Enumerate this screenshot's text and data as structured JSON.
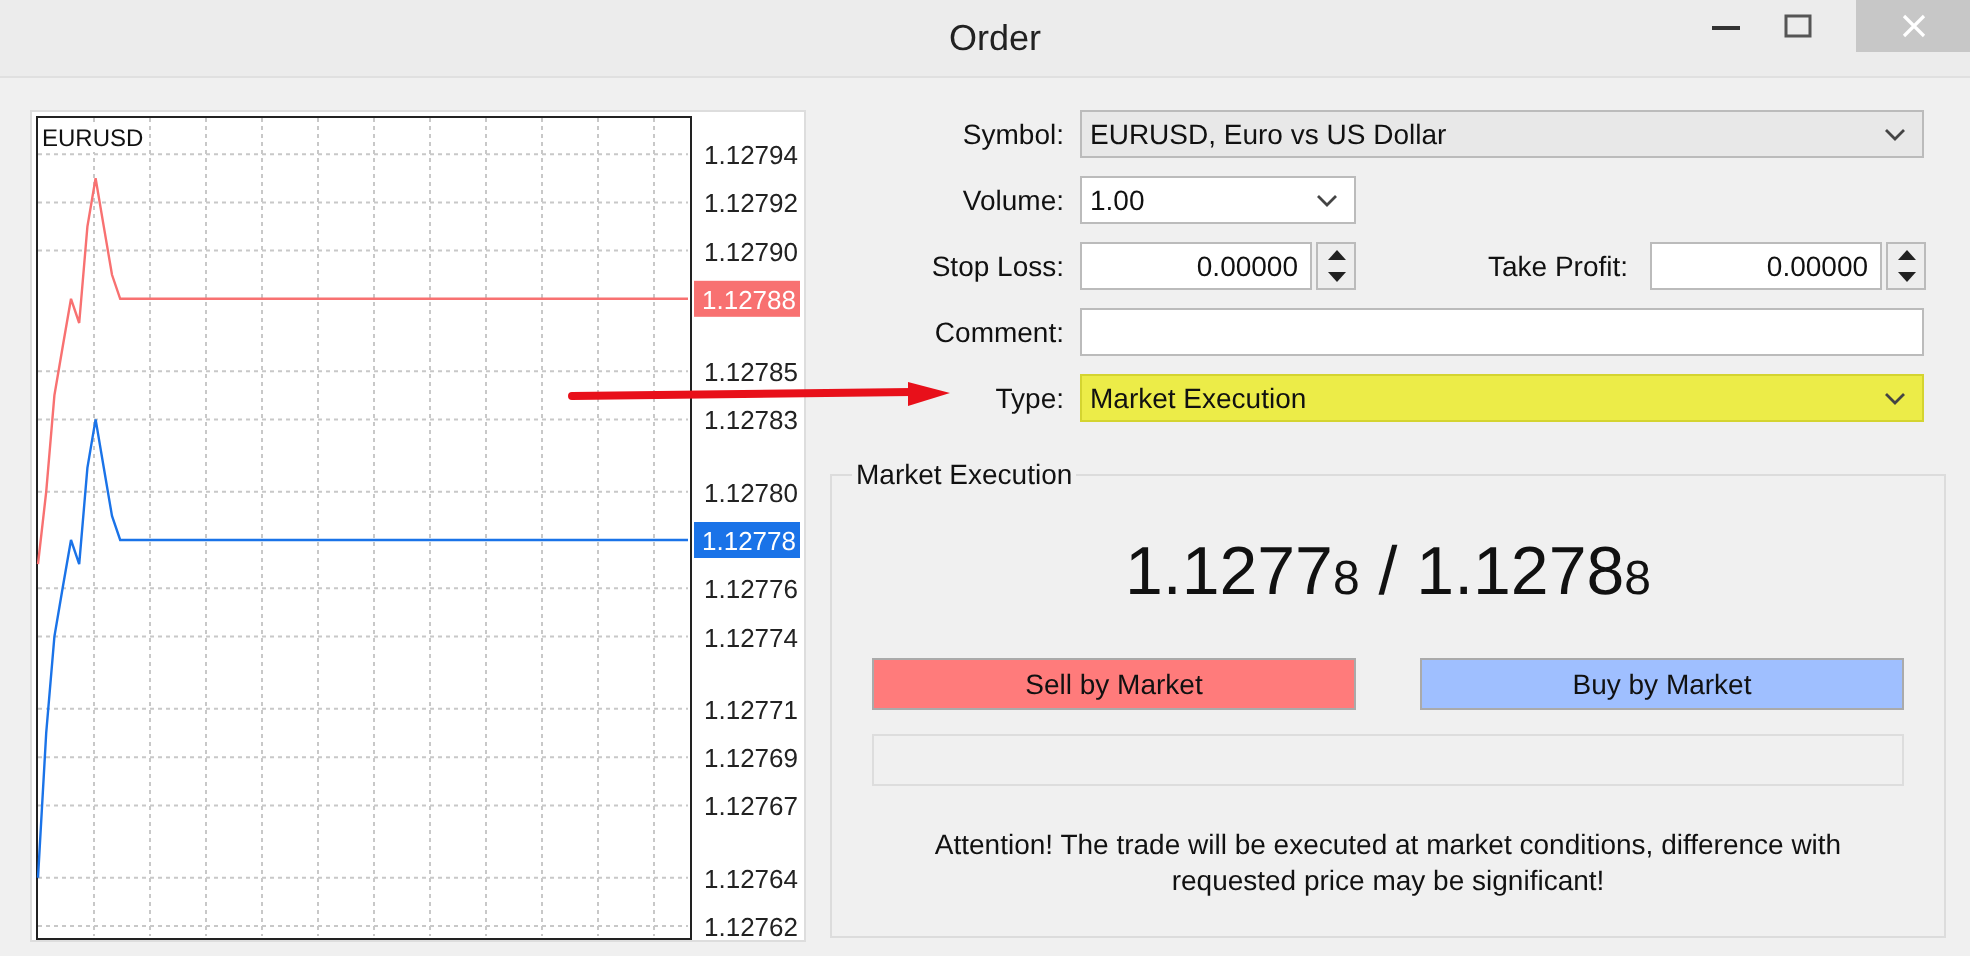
{
  "window": {
    "title": "Order"
  },
  "chart": {
    "symbol": "EURUSD",
    "chart_data": {
      "type": "line",
      "categories": [
        null,
        null,
        null,
        null,
        null,
        null,
        null,
        null,
        null,
        null,
        null,
        null,
        null,
        null,
        null,
        null,
        null,
        null,
        null,
        null,
        null,
        null,
        null,
        null,
        null,
        null,
        null,
        null,
        null,
        null,
        null,
        null,
        null,
        null,
        null,
        null,
        null,
        null,
        null,
        null,
        null,
        null,
        null,
        null,
        null,
        null,
        null,
        null,
        null,
        null,
        null,
        null,
        null,
        null,
        null,
        null,
        null,
        null,
        null,
        null,
        null,
        null,
        null,
        null,
        null,
        null,
        null,
        null,
        null,
        null,
        null,
        null,
        null,
        null,
        null,
        null,
        null,
        null,
        null,
        null
      ],
      "ylim": [
        1.127615,
        1.127955
      ],
      "grid": true,
      "yticks": [
        {
          "value": 1.12794,
          "label": "1.12794"
        },
        {
          "value": 1.12792,
          "label": "1.12792"
        },
        {
          "value": 1.1279,
          "label": "1.12790"
        },
        {
          "value": 1.12785,
          "label": "1.12785"
        },
        {
          "value": 1.12783,
          "label": "1.12783"
        },
        {
          "value": 1.1278,
          "label": "1.12780"
        },
        {
          "value": 1.12776,
          "label": "1.12776"
        },
        {
          "value": 1.12774,
          "label": "1.12774"
        },
        {
          "value": 1.12771,
          "label": "1.12771"
        },
        {
          "value": 1.12769,
          "label": "1.12769"
        },
        {
          "value": 1.12767,
          "label": "1.12767"
        },
        {
          "value": 1.12764,
          "label": "1.12764"
        },
        {
          "value": 1.12762,
          "label": "1.12762"
        }
      ],
      "series": [
        {
          "color": "#f87171",
          "values": [
            1.12777,
            1.1278,
            1.12784,
            1.12786,
            1.12788,
            1.12787,
            1.12791,
            1.12793,
            1.12791,
            1.12789,
            1.12788,
            1.12788,
            1.12788,
            1.12788,
            1.12788,
            1.12788,
            1.12788,
            1.12788,
            1.12788,
            1.12788,
            1.12788,
            1.12788,
            1.12788,
            1.12788,
            1.12788,
            1.12788,
            1.12788,
            1.12788,
            1.12788,
            1.12788,
            1.12788,
            1.12788,
            1.12788,
            1.12788,
            1.12788,
            1.12788,
            1.12788,
            1.12788,
            1.12788,
            1.12788,
            1.12788,
            1.12788,
            1.12788,
            1.12788,
            1.12788,
            1.12788,
            1.12788,
            1.12788,
            1.12788,
            1.12788,
            1.12788,
            1.12788,
            1.12788,
            1.12788,
            1.12788,
            1.12788,
            1.12788,
            1.12788,
            1.12788,
            1.12788,
            1.12788,
            1.12788,
            1.12788,
            1.12788,
            1.12788,
            1.12788,
            1.12788,
            1.12788,
            1.12788,
            1.12788,
            1.12788,
            1.12788,
            1.12788,
            1.12788,
            1.12788,
            1.12788,
            1.12788,
            1.12788,
            1.12788,
            1.12788
          ]
        },
        {
          "color": "#1a73e8",
          "values": [
            1.12764,
            1.1277,
            1.12774,
            1.12776,
            1.12778,
            1.12777,
            1.12781,
            1.12783,
            1.12781,
            1.12779,
            1.12778,
            1.12778,
            1.12778,
            1.12778,
            1.12778,
            1.12778,
            1.12778,
            1.12778,
            1.12778,
            1.12778,
            1.12778,
            1.12778,
            1.12778,
            1.12778,
            1.12778,
            1.12778,
            1.12778,
            1.12778,
            1.12778,
            1.12778,
            1.12778,
            1.12778,
            1.12778,
            1.12778,
            1.12778,
            1.12778,
            1.12778,
            1.12778,
            1.12778,
            1.12778,
            1.12778,
            1.12778,
            1.12778,
            1.12778,
            1.12778,
            1.12778,
            1.12778,
            1.12778,
            1.12778,
            1.12778,
            1.12778,
            1.12778,
            1.12778,
            1.12778,
            1.12778,
            1.12778,
            1.12778,
            1.12778,
            1.12778,
            1.12778,
            1.12778,
            1.12778,
            1.12778,
            1.12778,
            1.12778,
            1.12778,
            1.12778,
            1.12778,
            1.12778,
            1.12778,
            1.12778,
            1.12778,
            1.12778,
            1.12778,
            1.12778,
            1.12778,
            1.12778,
            1.12778,
            1.12778,
            1.12778
          ]
        }
      ]
    },
    "price_labels": [
      {
        "label": "1.12788",
        "color": "#f87171"
      },
      {
        "label": "1.12778",
        "color": "#1a73e8"
      }
    ]
  },
  "form": [
    {
      "kind": "dropdown",
      "label": "Symbol:",
      "value": "EURUSD, Euro vs US Dollar",
      "highlighted": false
    },
    {
      "kind": "combo",
      "label": "Volume:",
      "value": "1.00",
      "highlighted": false
    },
    {
      "kind": "spin_pair",
      "label": "Stop Loss:",
      "value": "0.00000",
      "label_2": "Take Profit:",
      "value_2": "0.00000"
    },
    {
      "kind": "text",
      "label": "Comment:"
    },
    {
      "kind": "dropdown",
      "label": "Type:",
      "value": "Market Execution",
      "highlighted": true
    }
  ],
  "execution": {
    "title": "Market Execution",
    "quote": "1.1277$_{8}$ / 1.1278$_{8}$",
    "buttons": [
      {
        "kind": "sell",
        "label": "Sell by Market"
      },
      {
        "kind": "buy",
        "label": "Buy by Market"
      }
    ],
    "notice": "Attention! The trade will be executed at market conditions, difference with requested price may be significant!"
  }
}
